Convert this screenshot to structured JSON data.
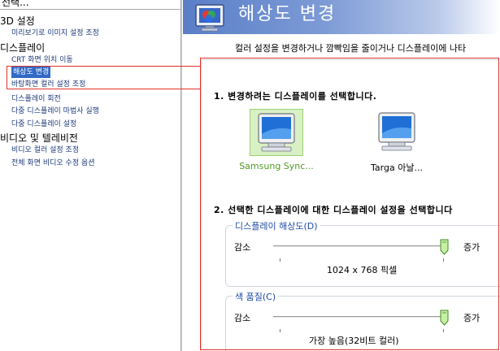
{
  "tree": {
    "title": "선택...",
    "items": [
      {
        "label": "3D 설정",
        "kind": "cat",
        "selected": false
      },
      {
        "label": "미리보기로 이미지 설정 조정",
        "kind": "task",
        "selected": false
      },
      {
        "label": "디스플레이",
        "kind": "cat",
        "selected": false
      },
      {
        "label": "CRT 화면 위치 이동",
        "kind": "task",
        "selected": false
      },
      {
        "label": "해상도 변경",
        "kind": "task",
        "selected": true
      },
      {
        "label": "바탕화면 컬러 설정 조정",
        "kind": "task",
        "selected": false
      },
      {
        "label": "디스플레이 회전",
        "kind": "task",
        "selected": false
      },
      {
        "label": "다중 디스플레이 마법사 실행",
        "kind": "task",
        "selected": false
      },
      {
        "label": "다중 디스플레이 설정",
        "kind": "task",
        "selected": false
      },
      {
        "label": "비디오 및 텔레비전",
        "kind": "cat",
        "selected": false
      },
      {
        "label": "비디오 컬러 설정 조정",
        "kind": "task",
        "selected": false
      },
      {
        "label": "전체 화면 비디오 수정 옵션",
        "kind": "task",
        "selected": false
      }
    ]
  },
  "header": {
    "title": "해상도 변경",
    "subtitle": "컬러 설정을 변경하거나 깜빡임을 줄이거나 디스플레이에 나타"
  },
  "step1": {
    "heading": "1. 변경하려는 디스플레이를 선택합니다.",
    "displays": [
      {
        "label": "Samsung Sync...",
        "selected": true
      },
      {
        "label": "Targa 아날...",
        "selected": false
      }
    ]
  },
  "step2": {
    "heading": "2. 선택한 디스플레이에 대한 디스플레이 설정을 선택합니다",
    "resolution": {
      "legend": "디스플레이 해상도(D)",
      "low": "감소",
      "high": "증가",
      "value": "1024 x 768 픽셀",
      "level": 1.0
    },
    "color": {
      "legend": "색 품질(C)",
      "low": "감소",
      "high": "증가",
      "value": "가장 높음(32비트 컬러)",
      "level": 1.0
    }
  },
  "colors": {
    "selection": "#316ac5",
    "annotation": "#e0312c",
    "selected_display_text": "#4f9a25",
    "legend": "#1f4aa8"
  },
  "icons": {
    "header": "display-properties-icon",
    "monitor": "crt-monitor-icon",
    "slider": "slider-thumb-icon"
  }
}
